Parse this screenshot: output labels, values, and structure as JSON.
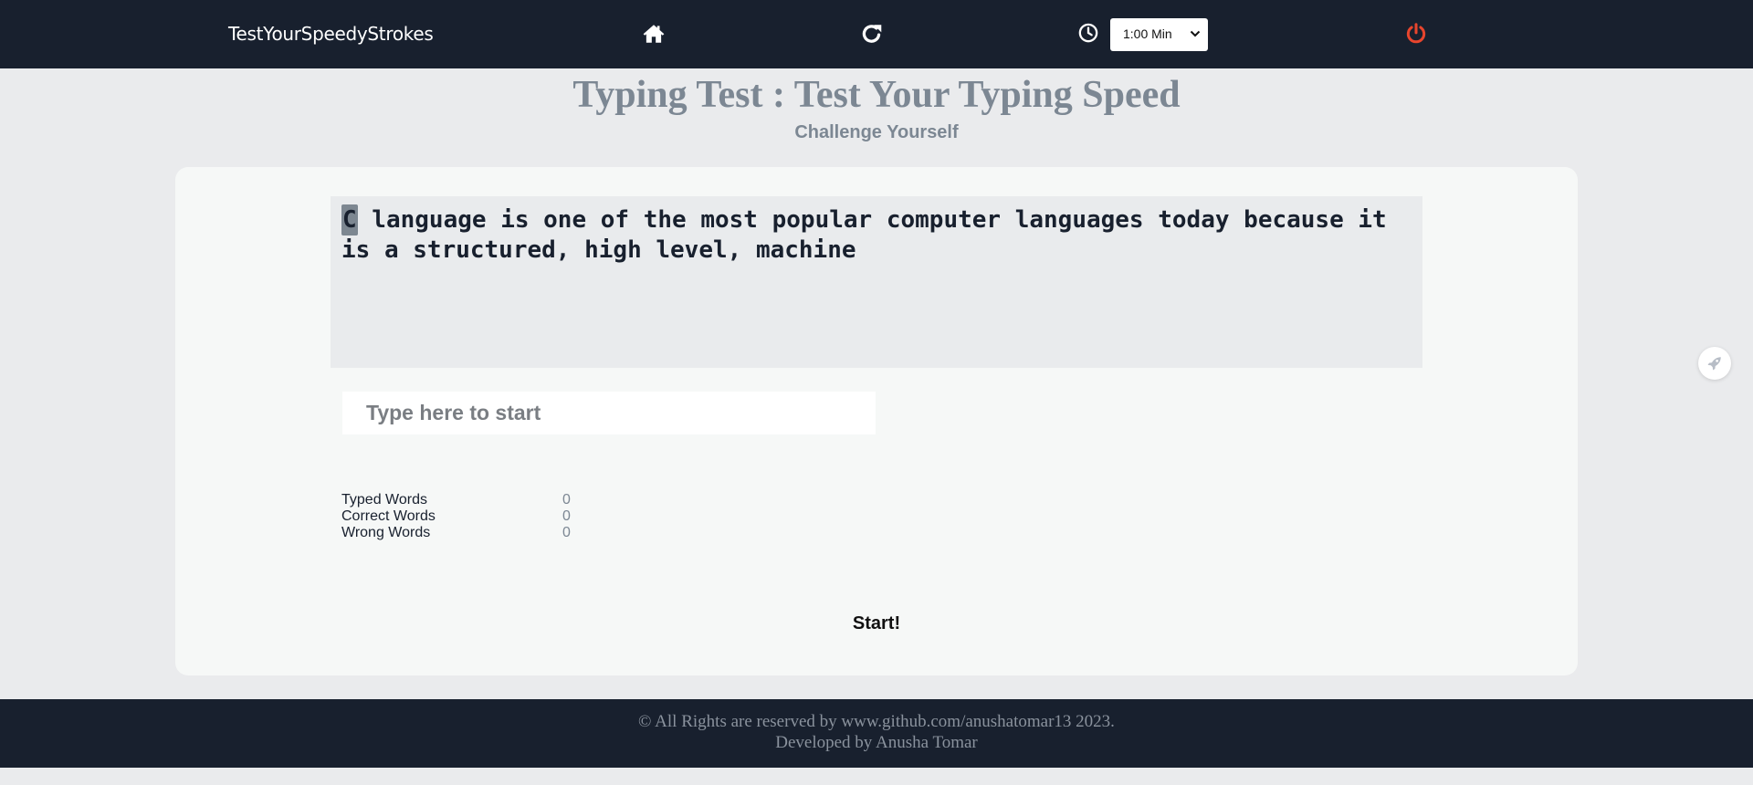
{
  "nav": {
    "brand": "TestYourSpeedyStrokes",
    "icons": [
      "home-icon",
      "refresh-icon",
      "clock-icon",
      "power-icon"
    ],
    "timer_selected": "1:00 Min",
    "power_color": "#e8452d"
  },
  "header": {
    "title": "Typing Test : Test Your Typing Speed",
    "subtitle": "Challenge Yourself"
  },
  "passage": {
    "current_char": "C",
    "rest": " language is one of the most popular computer languages today because it is a structured, high level, machine"
  },
  "input": {
    "placeholder": "Type here to start",
    "value": ""
  },
  "stats": {
    "typed_label": "Typed Words",
    "typed_value": "0",
    "correct_label": "Correct Words",
    "correct_value": "0",
    "wrong_label": "Wrong Words",
    "wrong_value": "0"
  },
  "start_label": "Start!",
  "footer": {
    "line1": "© All Rights are reserved by www.github.com/anushatomar13 2023.",
    "line2": "Developed by Anusha Tomar"
  },
  "colors": {
    "navbar": "#18202e",
    "page_bg": "#eaebed",
    "card_bg": "#f6f8f7",
    "heading": "#7c8793"
  }
}
